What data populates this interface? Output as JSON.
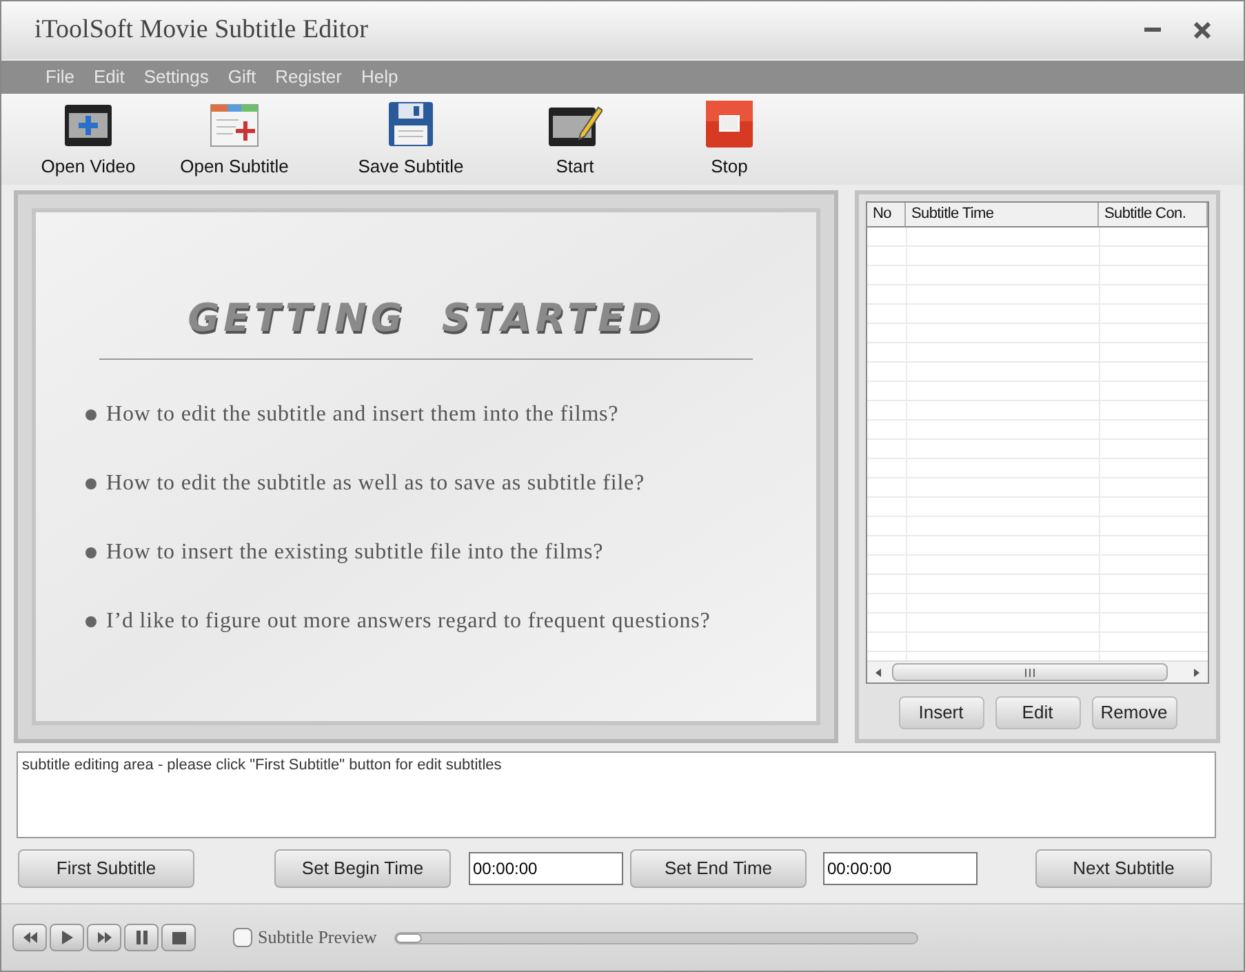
{
  "window": {
    "title": "iToolSoft Movie Subtitle Editor"
  },
  "menu": [
    "File",
    "Edit",
    "Settings",
    "Gift",
    "Register",
    "Help"
  ],
  "toolbar": [
    {
      "kind": "open-video",
      "label": "Open Video"
    },
    {
      "kind": "open-subtitle",
      "label": "Open Subtitle"
    },
    {
      "kind": "save",
      "label": "Save Subtitle"
    },
    {
      "kind": "start",
      "label": "Start"
    },
    {
      "kind": "stop",
      "label": "Stop"
    }
  ],
  "getting_started": {
    "title": "GETTING  STARTED",
    "items": [
      "How to edit the subtitle and insert them into the films?",
      "How to edit the subtitle as well as to save as subtitle file?",
      "How to insert the existing subtitle file into the films?",
      "I’d like to figure out more answers regard to frequent questions?"
    ]
  },
  "subtitle_table": {
    "columns": [
      "No",
      "Subtitle Time",
      "Subtitle Con."
    ],
    "buttons": [
      "Insert",
      "Edit",
      "Remove"
    ]
  },
  "editing_area": {
    "value": "subtitle editing area - please click \"First Subtitle\" button for edit subtitles"
  },
  "controls": [
    {
      "kind": "button",
      "label": "First Subtitle"
    },
    {
      "kind": "button",
      "label": "Set Begin Time"
    },
    {
      "kind": "field",
      "value": "00:00:00"
    },
    {
      "kind": "button",
      "label": "Set End Time"
    },
    {
      "kind": "field",
      "value": "00:00:00"
    },
    {
      "kind": "button",
      "label": "Next Subtitle"
    }
  ],
  "player": {
    "buttons": [
      {
        "kind": "rewind"
      },
      {
        "kind": "play"
      },
      {
        "kind": "fast-forward"
      },
      {
        "kind": "pause"
      },
      {
        "kind": "stop"
      }
    ],
    "subtitle_preview": {
      "label": "Subtitle Preview",
      "checked": false
    },
    "progress": {
      "level": 0.05
    }
  }
}
